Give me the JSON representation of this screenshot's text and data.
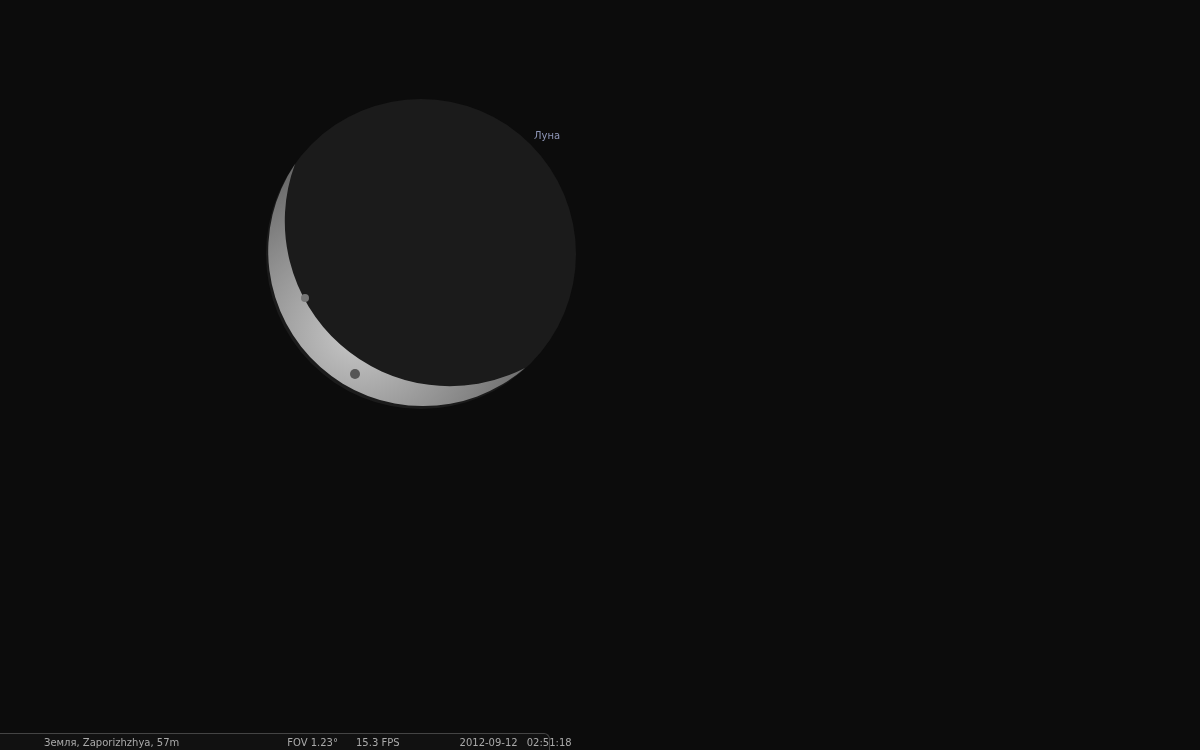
{
  "sky": {
    "object_label": "Луна"
  },
  "status_bar": {
    "location": "Земля, Zaporizhzhya, 57m",
    "fov": "FOV 1.23°",
    "fps": "15.3 FPS",
    "date": "2012-09-12",
    "time": "02:51:18"
  }
}
